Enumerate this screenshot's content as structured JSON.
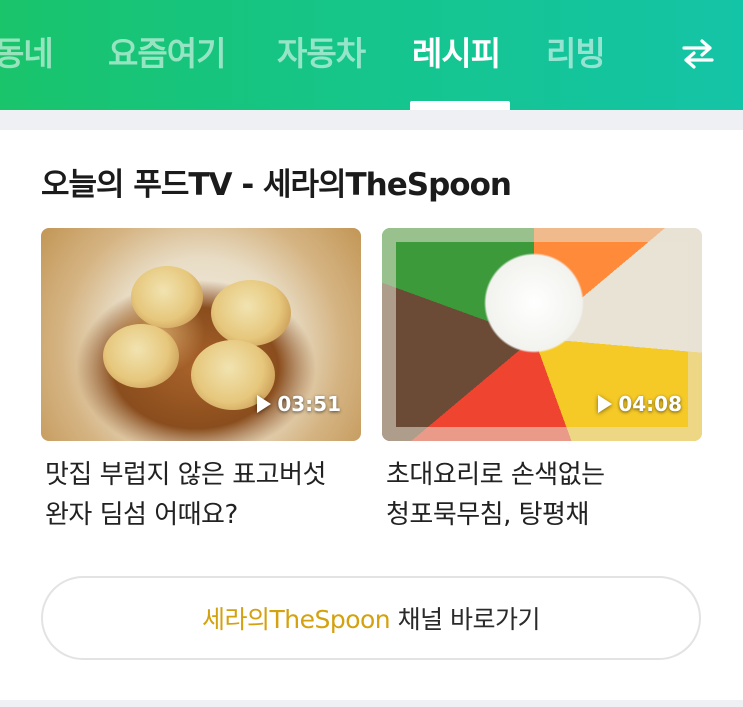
{
  "nav": {
    "tabs": [
      {
        "label": "동네",
        "active": false
      },
      {
        "label": "요즘여기",
        "active": false
      },
      {
        "label": "자동차",
        "active": false
      },
      {
        "label": "레시피",
        "active": true
      },
      {
        "label": "리빙",
        "active": false
      }
    ],
    "swap_icon": "swap-arrows-icon"
  },
  "section": {
    "title": "오늘의 푸드TV - 세라의TheSpoon"
  },
  "videos": [
    {
      "title": "맛집 부럽지 않은 표고버섯 완자 딤섬 어때요?",
      "duration": "03:51"
    },
    {
      "title": "초대요리로 손색없는 청포묵무침, 탕평채",
      "duration": "04:08"
    }
  ],
  "channel_button": {
    "channel_name": "세라의TheSpoon",
    "suffix": " 채널 바로가기"
  },
  "colors": {
    "nav_gradient_start": "#19c46b",
    "nav_gradient_end": "#14c4a6",
    "channel_accent": "#d4a20f"
  }
}
